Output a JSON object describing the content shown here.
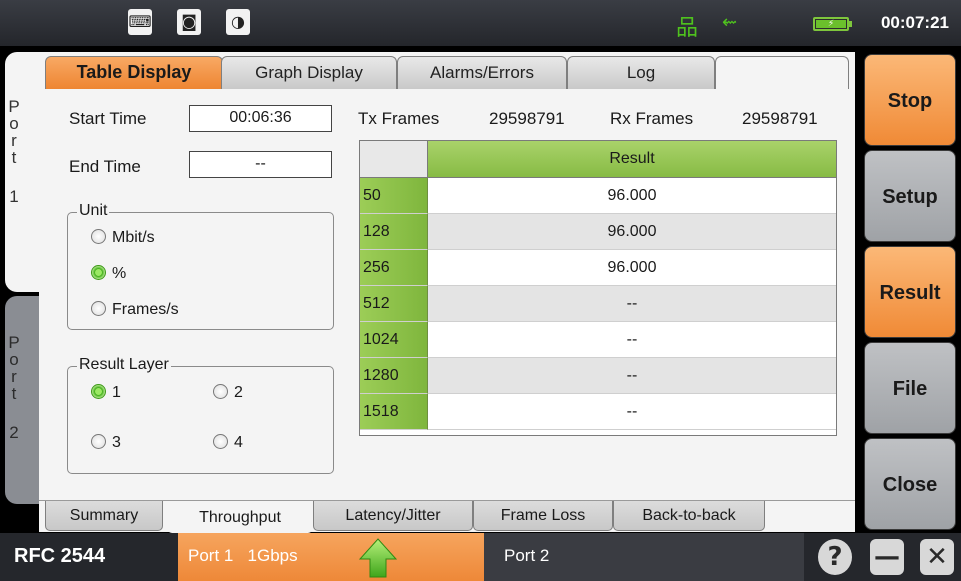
{
  "status_bar": {
    "icons": [
      "keyboard-icon",
      "screenshot-icon",
      "contrast-icon",
      "network-icon",
      "usb-icon",
      "battery-icon"
    ],
    "clock": "00:07:21",
    "accent": "#4fc21e"
  },
  "port_tabs": {
    "port1": [
      "P",
      "o",
      "r",
      "t",
      "1"
    ],
    "port2": [
      "P",
      "o",
      "r",
      "t",
      "2"
    ]
  },
  "tabs": [
    "Table Display",
    "Graph Display",
    "Alarms/Errors",
    "Log"
  ],
  "fields": {
    "start_time_label": "Start Time",
    "start_time_value": "00:06:36",
    "end_time_label": "End Time",
    "end_time_value": "--",
    "tx_frames_label": "Tx Frames",
    "tx_frames_value": "29598791",
    "rx_frames_label": "Rx Frames",
    "rx_frames_value": "29598791"
  },
  "unit_group": {
    "title": "Unit",
    "options": [
      "Mbit/s",
      "%",
      "Frames/s"
    ],
    "selected": "%"
  },
  "layer_group": {
    "title": "Result Layer",
    "options": [
      "1",
      "2",
      "3",
      "4"
    ],
    "selected": "1"
  },
  "table": {
    "header": "Result",
    "rows": [
      {
        "frame_size": "50",
        "result": "96.000"
      },
      {
        "frame_size": "128",
        "result": "96.000"
      },
      {
        "frame_size": "256",
        "result": "96.000"
      },
      {
        "frame_size": "512",
        "result": "--"
      },
      {
        "frame_size": "1024",
        "result": "--"
      },
      {
        "frame_size": "1280",
        "result": "--"
      },
      {
        "frame_size": "1518",
        "result": "--"
      }
    ]
  },
  "sub_tabs": [
    "Summary",
    "Throughput",
    "Latency/Jitter",
    "Frame Loss",
    "Back-to-back"
  ],
  "active_sub_tab": "Throughput",
  "side_buttons": [
    "Stop",
    "Setup",
    "Result",
    "File",
    "Close"
  ],
  "bottom_bar": {
    "mode": "RFC 2544",
    "port1_label": "Port 1",
    "port1_speed": "1Gbps",
    "port2_label": "Port 2",
    "help_icon": "help-icon",
    "minimize_icon": "minimize-icon",
    "close_icon": "close-icon"
  },
  "colors": {
    "orange": "#f08a36",
    "green": "#87bb44",
    "grey": "#9fa2a6"
  }
}
